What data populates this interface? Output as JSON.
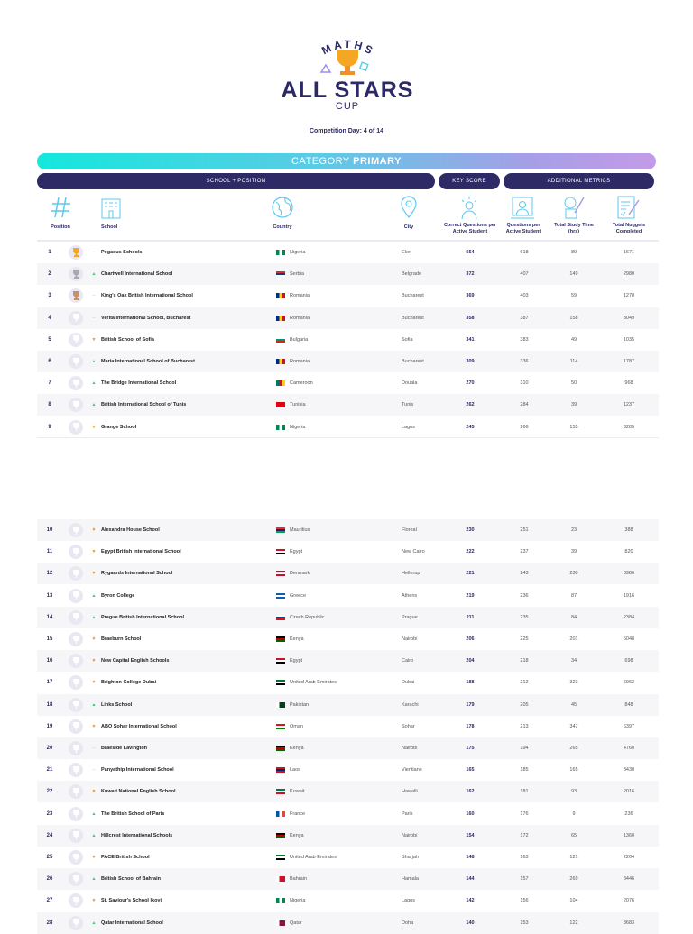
{
  "logo": {
    "top_word": "MATHS",
    "title": "ALL STARS",
    "subtitle": "CUP"
  },
  "competition_day": "Competition Day: 4 of 14",
  "category": {
    "prefix": "CATEGORY",
    "name": "PRIMARY"
  },
  "groups": {
    "school_position": "SCHOOL + POSITION",
    "key_score": "KEY SCORE",
    "additional": "ADDITIONAL METRICS"
  },
  "columns": {
    "position": "Position",
    "school": "School",
    "country": "Country",
    "city": "City",
    "key": "Correct Questions per Active Student",
    "qpas": "Questions per Active Student",
    "study": "Total Study Time (hrs)",
    "nuggets": "Total Nuggets Completed"
  },
  "colors": {
    "navy": "#2d2a66",
    "up": "#2ecc71",
    "down": "#f0902a",
    "gold": "#f5a623",
    "silver": "#a8a8b0",
    "bronze": "#c8906a"
  },
  "rows": [
    {
      "pos": "1",
      "trend": "same",
      "school": "Pegasus Schools",
      "country": "Nigeria",
      "flag": "ng",
      "city": "Eket",
      "key": "554",
      "qpas": "618",
      "study": "89",
      "nuggets": "1671"
    },
    {
      "pos": "2",
      "trend": "up",
      "school": "Chartwell International School",
      "country": "Serbia",
      "flag": "rs",
      "city": "Belgrade",
      "key": "372",
      "qpas": "407",
      "study": "149",
      "nuggets": "2980"
    },
    {
      "pos": "3",
      "trend": "same",
      "school": "King's Oak British International School",
      "country": "Romania",
      "flag": "ro",
      "city": "Bucharest",
      "key": "369",
      "qpas": "403",
      "study": "59",
      "nuggets": "1278"
    },
    {
      "pos": "4",
      "trend": "same",
      "school": "Verita International School, Bucharest",
      "country": "Romania",
      "flag": "ro",
      "city": "Bucharest",
      "key": "358",
      "qpas": "387",
      "study": "158",
      "nuggets": "3049"
    },
    {
      "pos": "5",
      "trend": "down",
      "school": "British School of Sofia",
      "country": "Bulgaria",
      "flag": "bg",
      "city": "Sofia",
      "key": "341",
      "qpas": "383",
      "study": "49",
      "nuggets": "1035"
    },
    {
      "pos": "6",
      "trend": "up",
      "school": "Maria International School of Bucharest",
      "country": "Romania",
      "flag": "ro",
      "city": "Bucharest",
      "key": "309",
      "qpas": "336",
      "study": "114",
      "nuggets": "1787"
    },
    {
      "pos": "7",
      "trend": "up",
      "school": "The Bridge International School",
      "country": "Cameroon",
      "flag": "cm",
      "city": "Douala",
      "key": "270",
      "qpas": "310",
      "study": "50",
      "nuggets": "968"
    },
    {
      "pos": "8",
      "trend": "up",
      "school": "British International School of Tunis",
      "country": "Tunisia",
      "flag": "tn",
      "city": "Tunis",
      "key": "262",
      "qpas": "284",
      "study": "39",
      "nuggets": "1237"
    },
    {
      "pos": "9",
      "trend": "down",
      "school": "Grange School",
      "country": "Nigeria",
      "flag": "ng",
      "city": "Lagos",
      "key": "245",
      "qpas": "266",
      "study": "155",
      "nuggets": "3285"
    },
    {
      "pos": "10",
      "trend": "down",
      "school": "Alexandra House School",
      "country": "Mauritius",
      "flag": "mu",
      "city": "Floreal",
      "key": "230",
      "qpas": "251",
      "study": "23",
      "nuggets": "388"
    },
    {
      "pos": "11",
      "trend": "down",
      "school": "Egypt British International School",
      "country": "Egypt",
      "flag": "eg",
      "city": "New Cairo",
      "key": "222",
      "qpas": "237",
      "study": "39",
      "nuggets": "820"
    },
    {
      "pos": "12",
      "trend": "down",
      "school": "Rygaards International School",
      "country": "Denmark",
      "flag": "dk",
      "city": "Hellerup",
      "key": "221",
      "qpas": "243",
      "study": "230",
      "nuggets": "3986"
    },
    {
      "pos": "13",
      "trend": "up",
      "school": "Byron College",
      "country": "Greece",
      "flag": "gr",
      "city": "Athens",
      "key": "219",
      "qpas": "236",
      "study": "87",
      "nuggets": "1916"
    },
    {
      "pos": "14",
      "trend": "up",
      "school": "Prague British International School",
      "country": "Czech Republic",
      "flag": "cz",
      "city": "Prague",
      "key": "211",
      "qpas": "235",
      "study": "84",
      "nuggets": "2384"
    },
    {
      "pos": "15",
      "trend": "down",
      "school": "Braeburn School",
      "country": "Kenya",
      "flag": "ke",
      "city": "Nairobi",
      "key": "206",
      "qpas": "225",
      "study": "201",
      "nuggets": "5048"
    },
    {
      "pos": "16",
      "trend": "down",
      "school": "New Capital English Schools",
      "country": "Egypt",
      "flag": "eg",
      "city": "Cairo",
      "key": "204",
      "qpas": "218",
      "study": "34",
      "nuggets": "698"
    },
    {
      "pos": "17",
      "trend": "down",
      "school": "Brighton College Dubai",
      "country": "United Arab Emirates",
      "flag": "ae",
      "city": "Dubai",
      "key": "188",
      "qpas": "212",
      "study": "323",
      "nuggets": "6962"
    },
    {
      "pos": "18",
      "trend": "up",
      "school": "Links School",
      "country": "Pakistan",
      "flag": "pk",
      "city": "Karachi",
      "key": "179",
      "qpas": "205",
      "study": "45",
      "nuggets": "848"
    },
    {
      "pos": "19",
      "trend": "down",
      "school": "ABQ Sohar International School",
      "country": "Oman",
      "flag": "om",
      "city": "Sohar",
      "key": "178",
      "qpas": "213",
      "study": "347",
      "nuggets": "6397"
    },
    {
      "pos": "20",
      "trend": "same",
      "school": "Braeside Lavington",
      "country": "Kenya",
      "flag": "ke",
      "city": "Nairobi",
      "key": "175",
      "qpas": "194",
      "study": "265",
      "nuggets": "4760"
    },
    {
      "pos": "21",
      "trend": "same",
      "school": "Panyathip International School",
      "country": "Laos",
      "flag": "la",
      "city": "Vientiane",
      "key": "165",
      "qpas": "185",
      "study": "165",
      "nuggets": "3430"
    },
    {
      "pos": "22",
      "trend": "down",
      "school": "Kuwait National English School",
      "country": "Kuwait",
      "flag": "kw",
      "city": "Hawalli",
      "key": "162",
      "qpas": "181",
      "study": "93",
      "nuggets": "2016"
    },
    {
      "pos": "23",
      "trend": "up",
      "school": "The British School of Paris",
      "country": "France",
      "flag": "fr",
      "city": "Paris",
      "key": "160",
      "qpas": "176",
      "study": "9",
      "nuggets": "236"
    },
    {
      "pos": "24",
      "trend": "up",
      "school": "Hillcrest International Schools",
      "country": "Kenya",
      "flag": "ke",
      "city": "Nairobi",
      "key": "154",
      "qpas": "172",
      "study": "65",
      "nuggets": "1360"
    },
    {
      "pos": "25",
      "trend": "down",
      "school": "PACE British School",
      "country": "United Arab Emirates",
      "flag": "ae",
      "city": "Sharjah",
      "key": "148",
      "qpas": "163",
      "study": "121",
      "nuggets": "2204"
    },
    {
      "pos": "26",
      "trend": "up",
      "school": "British School of Bahrain",
      "country": "Bahrain",
      "flag": "bh",
      "city": "Hamala",
      "key": "144",
      "qpas": "157",
      "study": "269",
      "nuggets": "8446"
    },
    {
      "pos": "27",
      "trend": "down",
      "school": "St. Saviour's School Ikoyi",
      "country": "Nigeria",
      "flag": "ng",
      "city": "Lagos",
      "key": "142",
      "qpas": "156",
      "study": "104",
      "nuggets": "2076"
    },
    {
      "pos": "28",
      "trend": "up",
      "school": "Qatar International School",
      "country": "Qatar",
      "flag": "qa",
      "city": "Doha",
      "key": "140",
      "qpas": "153",
      "study": "122",
      "nuggets": "3683"
    }
  ]
}
